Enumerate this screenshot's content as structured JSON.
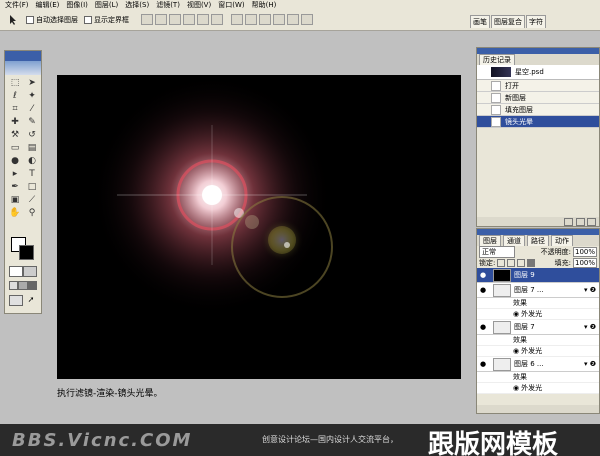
{
  "menubar": {
    "items": [
      "文件(F)",
      "编辑(E)",
      "图像(I)",
      "图层(L)",
      "选择(S)",
      "滤镜(T)",
      "视图(V)",
      "窗口(W)",
      "帮助(H)"
    ]
  },
  "options": {
    "auto_select": "自动选择图层",
    "show_bounds": "显示定界框"
  },
  "palette_well": {
    "tabs": [
      "画笔",
      "图层复合",
      "字符"
    ]
  },
  "history": {
    "tab": "历史记录",
    "snapshot": "星空.psd",
    "items": [
      "打开",
      "新图层",
      "填充图层",
      "镜头光晕"
    ],
    "active_index": 3
  },
  "layers": {
    "tabs": [
      "图层",
      "通道",
      "路径",
      "动作"
    ],
    "blend_mode": "正常",
    "opacity_label": "不透明度:",
    "opacity": "100%",
    "lock_label": "锁定:",
    "fill_label": "填充:",
    "fill": "100%",
    "rows": [
      {
        "name": "图层 9",
        "selected": true
      },
      {
        "name": "图层 7 ...",
        "effects": [
          "效果",
          "外发光"
        ]
      },
      {
        "name": "图层 7",
        "effects": [
          "效果",
          "外发光"
        ]
      },
      {
        "name": "图层 6 ...",
        "effects": [
          "效果",
          "外发光"
        ]
      }
    ]
  },
  "caption": "执行滤镜-渲染-镜头光晕。",
  "footer": {
    "url": "BBS.Vicnc.COM",
    "slogan": "创意设计论坛—国内设计人交流平台，",
    "brand": "跟版网模板"
  }
}
